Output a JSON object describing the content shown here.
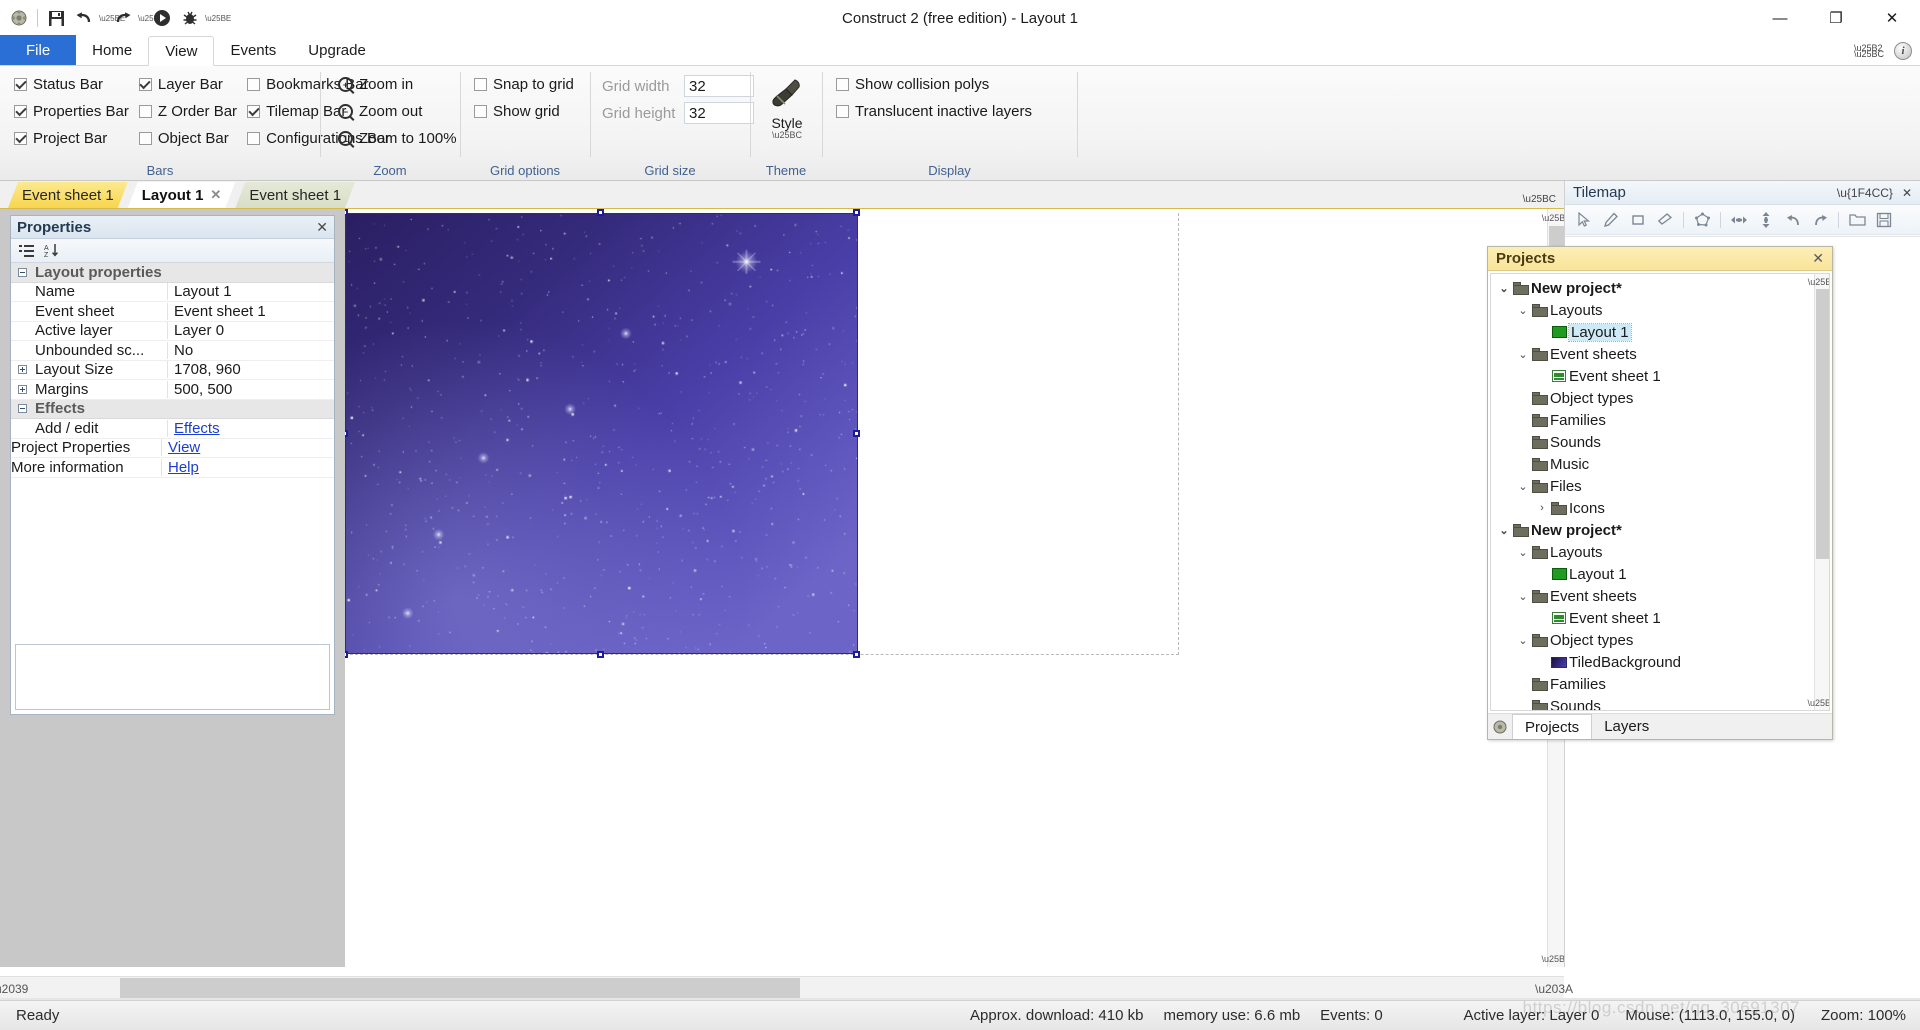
{
  "window": {
    "title": "Construct 2  (free edition) - Layout 1",
    "minimize": "—",
    "maximize": "❐",
    "close": "✕"
  },
  "quick_access": {
    "items": [
      {
        "name": "app-logo-icon",
        "glyph": "⚙"
      },
      {
        "name": "save-icon",
        "glyph": "ὋE"
      },
      {
        "name": "undo-icon",
        "glyph": "↶"
      },
      {
        "name": "redo-icon",
        "glyph": "↷"
      },
      {
        "name": "run-icon",
        "glyph": "▶"
      },
      {
        "name": "debug-icon",
        "glyph": "ὁE"
      }
    ]
  },
  "ribbon": {
    "tabs": [
      {
        "label": "File",
        "active": false,
        "kind": "file"
      },
      {
        "label": "Home",
        "active": false,
        "kind": "normal"
      },
      {
        "label": "View",
        "active": true,
        "kind": "normal"
      },
      {
        "label": "Events",
        "active": false,
        "kind": "normal"
      },
      {
        "label": "Upgrade",
        "active": false,
        "kind": "normal"
      }
    ],
    "groups": {
      "bars": {
        "label": "Bars",
        "items": [
          {
            "label": "Status Bar",
            "checked": true
          },
          {
            "label": "Layer Bar",
            "checked": true
          },
          {
            "label": "Bookmarks Bar",
            "checked": false
          },
          {
            "label": "Properties Bar",
            "checked": true
          },
          {
            "label": "Z Order Bar",
            "checked": false
          },
          {
            "label": "Tilemap Bar",
            "checked": true
          },
          {
            "label": "Project Bar",
            "checked": true
          },
          {
            "label": "Object Bar",
            "checked": false
          },
          {
            "label": "Configurations Bar",
            "checked": false
          }
        ]
      },
      "zoom": {
        "label": "Zoom",
        "items": [
          {
            "label": "Zoom in",
            "icon": "+"
          },
          {
            "label": "Zoom out",
            "icon": "−"
          },
          {
            "label": "Zoom to 100%",
            "icon": "1"
          }
        ]
      },
      "grid_options": {
        "label": "Grid options",
        "items": [
          {
            "label": "Snap to grid",
            "checked": false
          },
          {
            "label": "Show grid",
            "checked": false
          }
        ]
      },
      "grid_size": {
        "label": "Grid size",
        "fields": [
          {
            "label": "Grid width",
            "value": "32"
          },
          {
            "label": "Grid height",
            "value": "32"
          }
        ]
      },
      "theme": {
        "label": "Theme",
        "button": "Style"
      },
      "display": {
        "label": "Display",
        "items": [
          {
            "label": "Show collision polys",
            "checked": false
          },
          {
            "label": "Translucent inactive layers",
            "checked": false
          }
        ]
      }
    }
  },
  "document_tabs": [
    {
      "label": "Event sheet 1",
      "state": "inactive",
      "closable": false
    },
    {
      "label": "Layout 1",
      "state": "active",
      "closable": true,
      "close_glyph": "✕"
    },
    {
      "label": "Event sheet 1",
      "state": "greenish",
      "closable": false
    }
  ],
  "properties_panel": {
    "title": "Properties",
    "close_glyph": "✕",
    "toolbar": [
      {
        "name": "categorized-icon",
        "glyph": "≣"
      },
      {
        "name": "alphabetical-sort-icon",
        "glyph": "A↓"
      }
    ],
    "rows": [
      {
        "type": "category",
        "expander": "minus",
        "name": "Layout properties",
        "value": ""
      },
      {
        "type": "prop",
        "expander": "none",
        "name": "Name",
        "value": "Layout 1"
      },
      {
        "type": "prop",
        "expander": "none",
        "name": "Event sheet",
        "value": "Event sheet 1"
      },
      {
        "type": "prop",
        "expander": "none",
        "name": "Active layer",
        "value": "Layer 0"
      },
      {
        "type": "prop",
        "expander": "none",
        "name": "Unbounded sc...",
        "value": "No"
      },
      {
        "type": "prop",
        "expander": "plus",
        "name": "Layout Size",
        "value": "1708, 960"
      },
      {
        "type": "prop",
        "expander": "plus",
        "name": "Margins",
        "value": "500, 500"
      },
      {
        "type": "category",
        "expander": "minus",
        "name": "Effects",
        "value": ""
      },
      {
        "type": "prop",
        "expander": "none",
        "name": "Add / edit",
        "value": "Effects",
        "link": true
      },
      {
        "type": "prop-wide",
        "expander": "none",
        "name": "Project Properties",
        "value": "View",
        "link": true
      },
      {
        "type": "prop-wide",
        "expander": "none",
        "name": "More information",
        "value": "Help",
        "link": true
      }
    ]
  },
  "tilemap_bar": {
    "title": "Tilemap",
    "pin_glyph": "⚓",
    "close_glyph": "✕",
    "tools": [
      {
        "name": "select-arrow-icon",
        "glyph": "➤"
      },
      {
        "name": "pencil-icon",
        "glyph": "✎"
      },
      {
        "name": "rectangle-icon",
        "glyph": "□"
      },
      {
        "name": "eraser-icon",
        "glyph": "▱"
      },
      {
        "name": "polygon-icon",
        "glyph": "⬠"
      },
      {
        "name": "flip-horizontal-icon",
        "glyph": "↔"
      },
      {
        "name": "flip-vertical-icon",
        "glyph": "↕"
      },
      {
        "name": "undo-icon",
        "glyph": "↶"
      },
      {
        "name": "redo-icon",
        "glyph": "↷"
      },
      {
        "name": "open-folder-icon",
        "glyph": "Ὄ1"
      },
      {
        "name": "save-icon",
        "glyph": "ὋE"
      }
    ]
  },
  "projects_panel": {
    "title": "Projects",
    "close_glyph": "✕",
    "tree": [
      {
        "depth": 0,
        "twist": "⌄",
        "icon": "folder",
        "label": "New project*",
        "bold": true,
        "selected": false
      },
      {
        "depth": 1,
        "twist": "⌄",
        "icon": "folder",
        "label": "Layouts",
        "bold": false,
        "selected": false
      },
      {
        "depth": 2,
        "twist": "",
        "icon": "layout",
        "label": "Layout 1",
        "bold": false,
        "selected": true
      },
      {
        "depth": 1,
        "twist": "⌄",
        "icon": "folder",
        "label": "Event sheets",
        "bold": false,
        "selected": false
      },
      {
        "depth": 2,
        "twist": "",
        "icon": "sheet",
        "label": "Event sheet 1",
        "bold": false,
        "selected": false
      },
      {
        "depth": 1,
        "twist": "",
        "icon": "folder",
        "label": "Object types",
        "bold": false,
        "selected": false
      },
      {
        "depth": 1,
        "twist": "",
        "icon": "folder",
        "label": "Families",
        "bold": false,
        "selected": false
      },
      {
        "depth": 1,
        "twist": "",
        "icon": "folder",
        "label": "Sounds",
        "bold": false,
        "selected": false
      },
      {
        "depth": 1,
        "twist": "",
        "icon": "folder",
        "label": "Music",
        "bold": false,
        "selected": false
      },
      {
        "depth": 1,
        "twist": "⌄",
        "icon": "folder",
        "label": "Files",
        "bold": false,
        "selected": false
      },
      {
        "depth": 2,
        "twist": "›",
        "icon": "folder",
        "label": "Icons",
        "bold": false,
        "selected": false
      },
      {
        "depth": 0,
        "twist": "⌄",
        "icon": "folder",
        "label": "New project*",
        "bold": true,
        "selected": false
      },
      {
        "depth": 1,
        "twist": "⌄",
        "icon": "folder",
        "label": "Layouts",
        "bold": false,
        "selected": false
      },
      {
        "depth": 2,
        "twist": "",
        "icon": "layout",
        "label": "Layout 1",
        "bold": false,
        "selected": false
      },
      {
        "depth": 1,
        "twist": "⌄",
        "icon": "folder",
        "label": "Event sheets",
        "bold": false,
        "selected": false
      },
      {
        "depth": 2,
        "twist": "",
        "icon": "sheet",
        "label": "Event sheet 1",
        "bold": false,
        "selected": false
      },
      {
        "depth": 1,
        "twist": "⌄",
        "icon": "folder",
        "label": "Object types",
        "bold": false,
        "selected": false
      },
      {
        "depth": 2,
        "twist": "",
        "icon": "tiled",
        "label": "TiledBackground",
        "bold": false,
        "selected": false
      },
      {
        "depth": 1,
        "twist": "",
        "icon": "folder",
        "label": "Families",
        "bold": false,
        "selected": false
      },
      {
        "depth": 1,
        "twist": "",
        "icon": "folder",
        "label": "Sounds",
        "bold": false,
        "selected": false
      }
    ],
    "tabs": [
      {
        "label": "Projects",
        "active": true
      },
      {
        "label": "Layers",
        "active": false
      }
    ]
  },
  "status_bar": {
    "ready": "Ready",
    "download": "Approx. download: 410 kb",
    "memory": "memory use: 6.6 mb",
    "events": "Events: 0",
    "active_layer": "Active layer: Layer 0",
    "mouse": "Mouse: (1113.0, 155.0, 0)",
    "zoom": "Zoom: 100%"
  },
  "watermark": "https://blog.csdn.net/qq_30691307",
  "colors": {
    "file_tab": "#2a6fd6",
    "tab_yellow": "#f7d54e",
    "projects_header": "#f9e49a",
    "link": "#1a3fd0",
    "selection_handle": "#1b1b9c",
    "group_label": "#41618f"
  }
}
